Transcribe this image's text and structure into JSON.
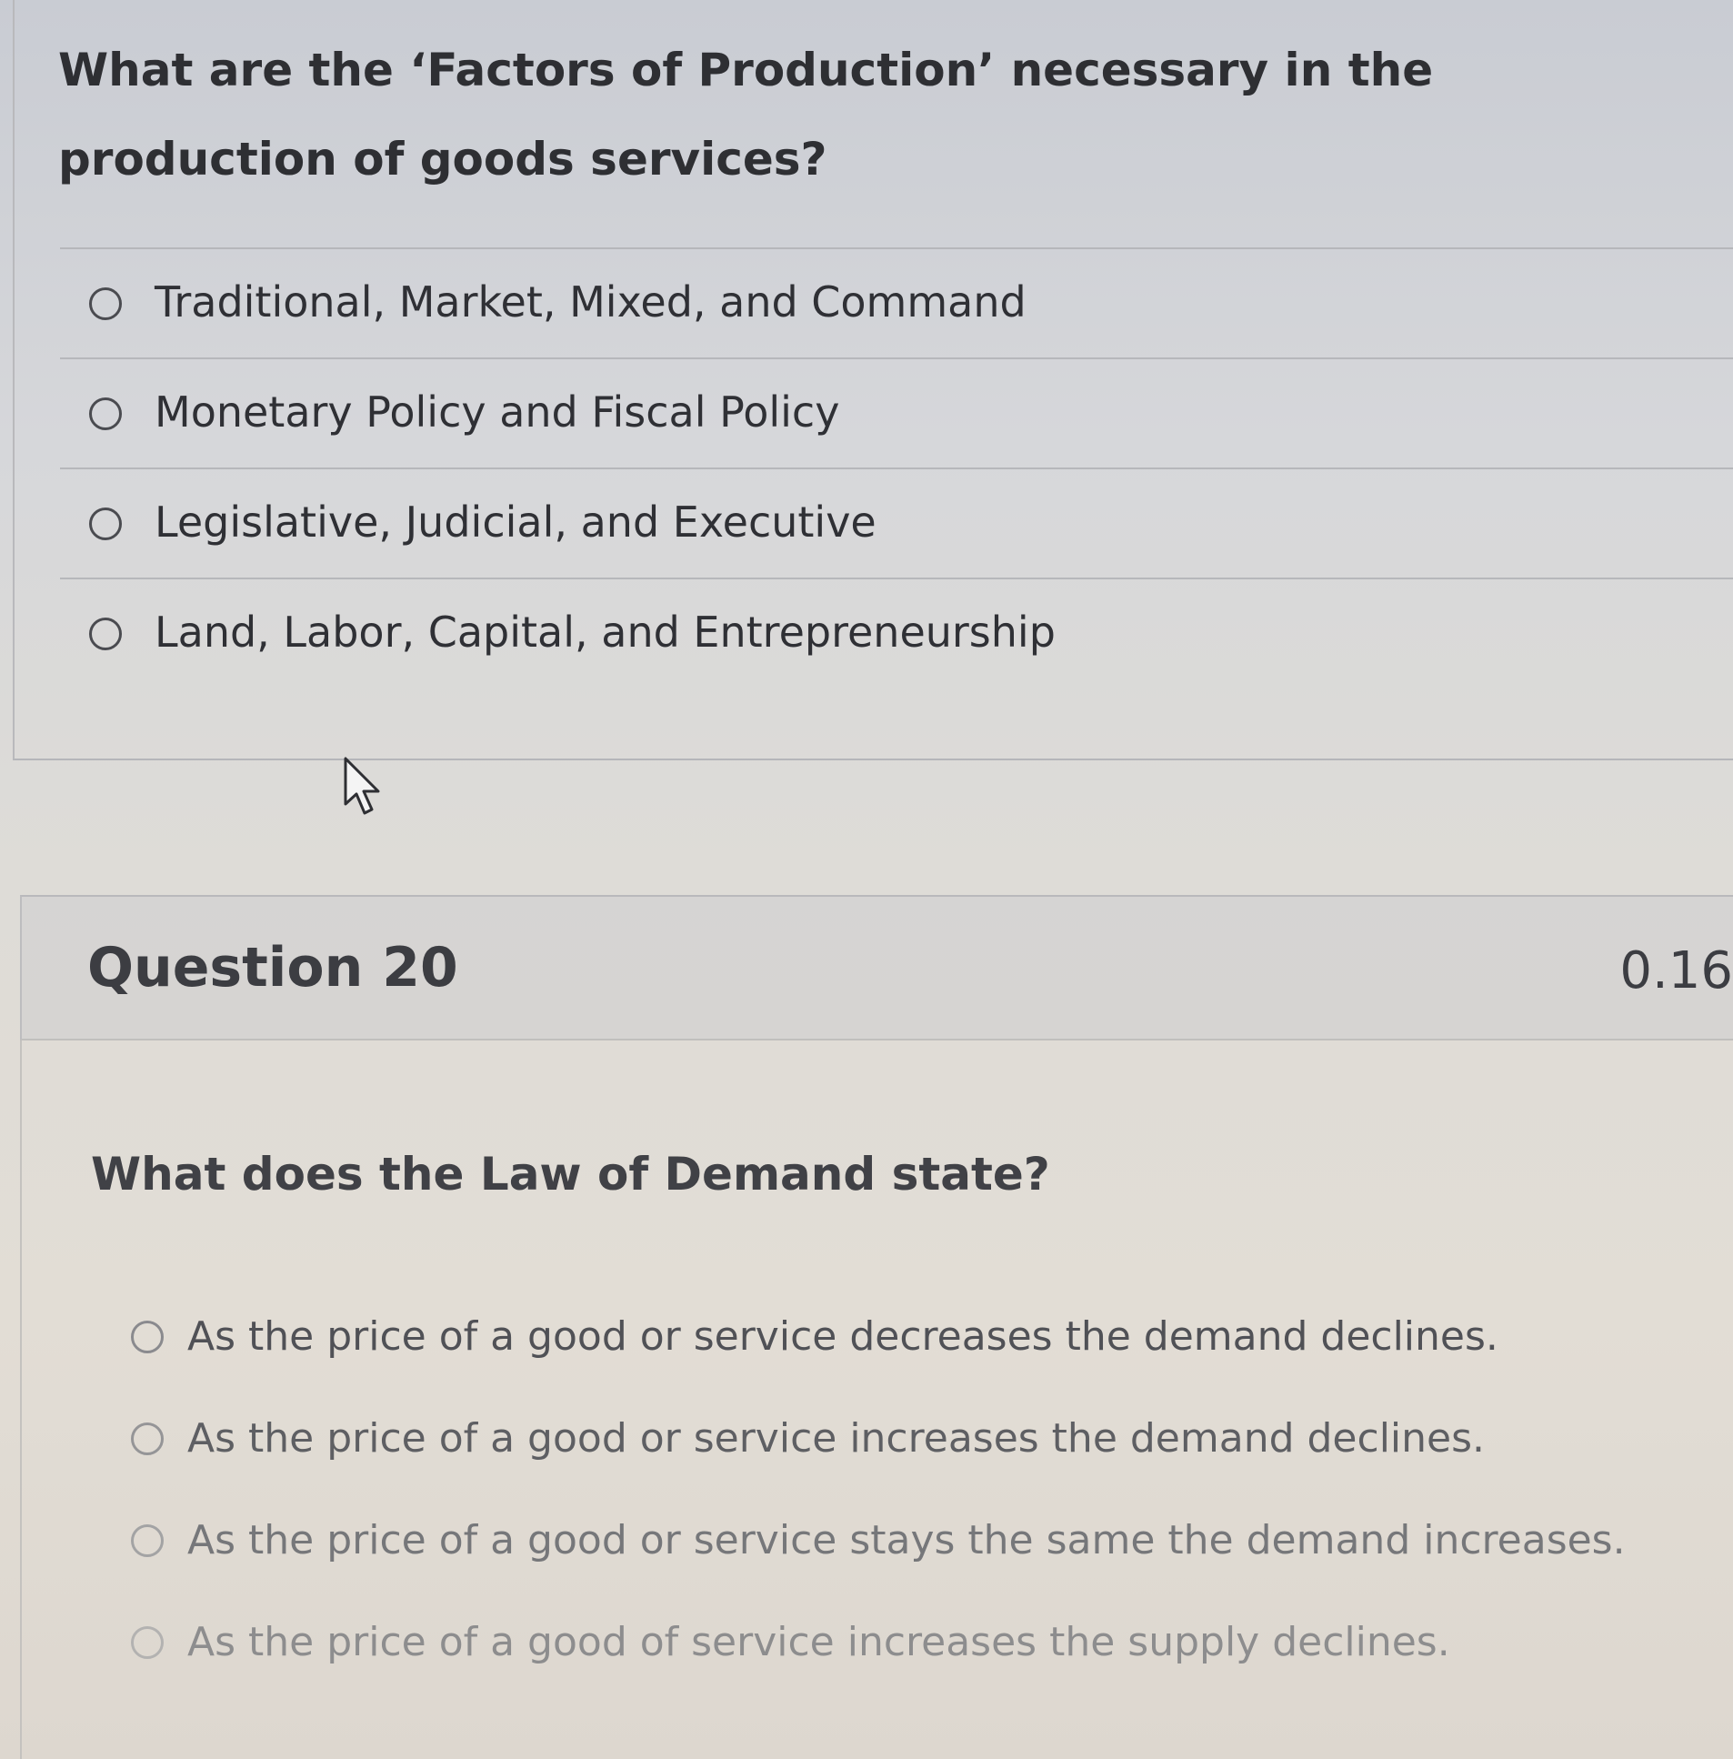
{
  "previous_question": {
    "text": "What are the ‘Factors of Production’ necessary in the production of goods services?",
    "options": [
      {
        "label": "Traditional, Market, Mixed, and Command",
        "selected": false
      },
      {
        "label": "Monetary Policy and Fiscal Policy",
        "selected": false
      },
      {
        "label": "Legislative, Judicial, and Executive",
        "selected": false
      },
      {
        "label": "Land, Labor, Capital, and Entrepreneurship",
        "selected": false
      }
    ]
  },
  "question_20": {
    "title": "Question 20",
    "points": "0.16",
    "text": "What does the Law of Demand state?",
    "options": [
      {
        "label": "As the price of a good or service decreases the demand declines.",
        "selected": false
      },
      {
        "label": "As the price of a good or service increases the demand declines.",
        "selected": false
      },
      {
        "label": "As the price of a good or service stays the same the demand increases.",
        "selected": false
      },
      {
        "label": "As the price of a good of service increases the supply declines.",
        "selected": false
      }
    ]
  },
  "icons": {
    "cursor": "mouse-pointer-icon",
    "radio": "radio-button-icon"
  }
}
